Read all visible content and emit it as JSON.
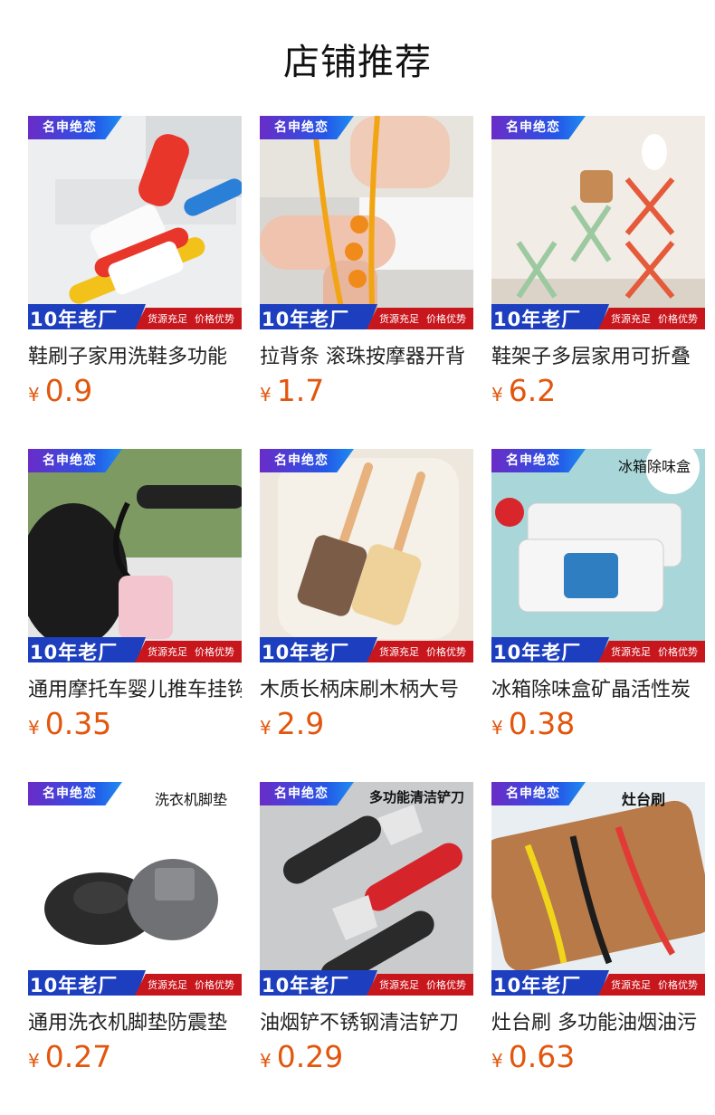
{
  "page_title": "店铺推荐",
  "brand_label": "名申绝恋",
  "badge_main": "10年老厂",
  "badge_tag1": "货源充足",
  "badge_tag2": "价格优势",
  "currency": "¥",
  "products": [
    {
      "name": "鞋刷子家用洗鞋多功能",
      "price": "0.9",
      "corner": ""
    },
    {
      "name": "拉背条 滚珠按摩器开背",
      "price": "1.7",
      "corner": ""
    },
    {
      "name": "鞋架子多层家用可折叠",
      "price": "6.2",
      "corner": ""
    },
    {
      "name": "通用摩托车婴儿推车挂钩",
      "price": "0.35",
      "corner": ""
    },
    {
      "name": "木质长柄床刷木柄大号",
      "price": "2.9",
      "corner": ""
    },
    {
      "name": "冰箱除味盒矿晶活性炭",
      "price": "0.38",
      "corner": "冰箱除味盒"
    },
    {
      "name": "通用洗衣机脚垫防震垫",
      "price": "0.27",
      "corner": "洗衣机脚垫"
    },
    {
      "name": "油烟铲不锈钢清洁铲刀",
      "price": "0.29",
      "corner": "多功能清洁铲刀"
    },
    {
      "name": "灶台刷 多功能油烟油污",
      "price": "0.63",
      "corner": "灶台刷"
    }
  ]
}
